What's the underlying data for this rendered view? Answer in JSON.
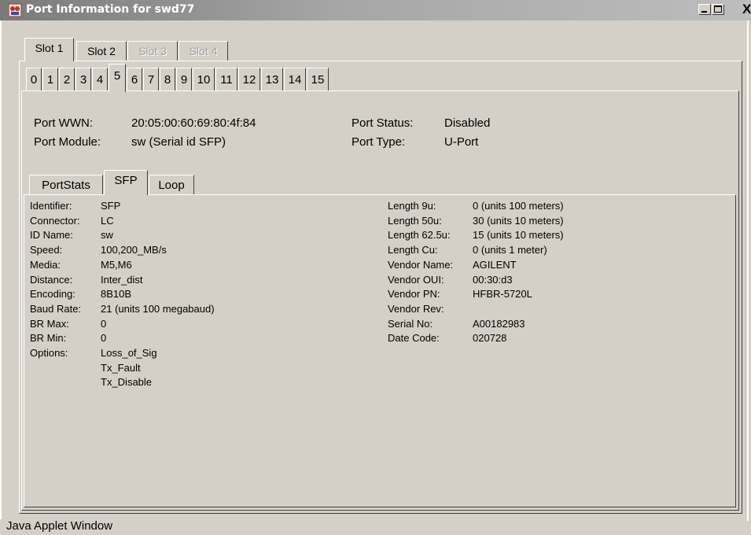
{
  "window": {
    "title": "Port Information for swd77",
    "status_bar": "Java Applet Window"
  },
  "slot_tabs": [
    {
      "label": "Slot 1",
      "selected": true,
      "enabled": true
    },
    {
      "label": "Slot 2",
      "selected": false,
      "enabled": true
    },
    {
      "label": "Slot 3",
      "selected": false,
      "enabled": false
    },
    {
      "label": "Slot 4",
      "selected": false,
      "enabled": false
    }
  ],
  "port_tabs": [
    "0",
    "1",
    "2",
    "3",
    "4",
    "5",
    "6",
    "7",
    "8",
    "9",
    "10",
    "11",
    "12",
    "13",
    "14",
    "15"
  ],
  "selected_port": "5",
  "port_info": {
    "wwn_label": "Port WWN:",
    "wwn_value": "20:05:00:60:69:80:4f:84",
    "module_label": "Port Module:",
    "module_value": "sw (Serial id SFP)",
    "status_label": "Port Status:",
    "status_value": "Disabled",
    "type_label": "Port Type:",
    "type_value": "U-Port"
  },
  "detail_tabs": [
    {
      "label": "PortStats",
      "selected": false
    },
    {
      "label": "SFP",
      "selected": true
    },
    {
      "label": "Loop",
      "selected": false
    }
  ],
  "sfp_left": [
    {
      "k": "Identifier:",
      "v": "SFP"
    },
    {
      "k": "Connector:",
      "v": "LC"
    },
    {
      "k": "ID Name:",
      "v": "sw"
    },
    {
      "k": "Speed:",
      "v": "100,200_MB/s"
    },
    {
      "k": "Media:",
      "v": "M5,M6"
    },
    {
      "k": "Distance:",
      "v": "Inter_dist"
    },
    {
      "k": "Encoding:",
      "v": "8B10B"
    },
    {
      "k": "Baud Rate:",
      "v": "21  (units 100 megabaud)"
    },
    {
      "k": "BR Max:",
      "v": "0"
    },
    {
      "k": "BR Min:",
      "v": "0"
    },
    {
      "k": "Options:",
      "v": "Loss_of_Sig"
    },
    {
      "k": "",
      "v": "Tx_Fault"
    },
    {
      "k": "",
      "v": "Tx_Disable"
    }
  ],
  "sfp_right": [
    {
      "k": "Length 9u:",
      "v": "0  (units 100 meters)"
    },
    {
      "k": "Length 50u:",
      "v": "30  (units 10 meters)"
    },
    {
      "k": "Length 62.5u:",
      "v": "15  (units 10 meters)"
    },
    {
      "k": "Length Cu:",
      "v": "0  (units 1 meter)"
    },
    {
      "k": "Vendor Name:",
      "v": "AGILENT"
    },
    {
      "k": "Vendor OUI:",
      "v": "00:30:d3"
    },
    {
      "k": "Vendor PN:",
      "v": "HFBR-5720L"
    },
    {
      "k": "Vendor Rev:",
      "v": ""
    },
    {
      "k": "Serial No:",
      "v": "A00182983"
    },
    {
      "k": "Date Code:",
      "v": "020728"
    }
  ]
}
